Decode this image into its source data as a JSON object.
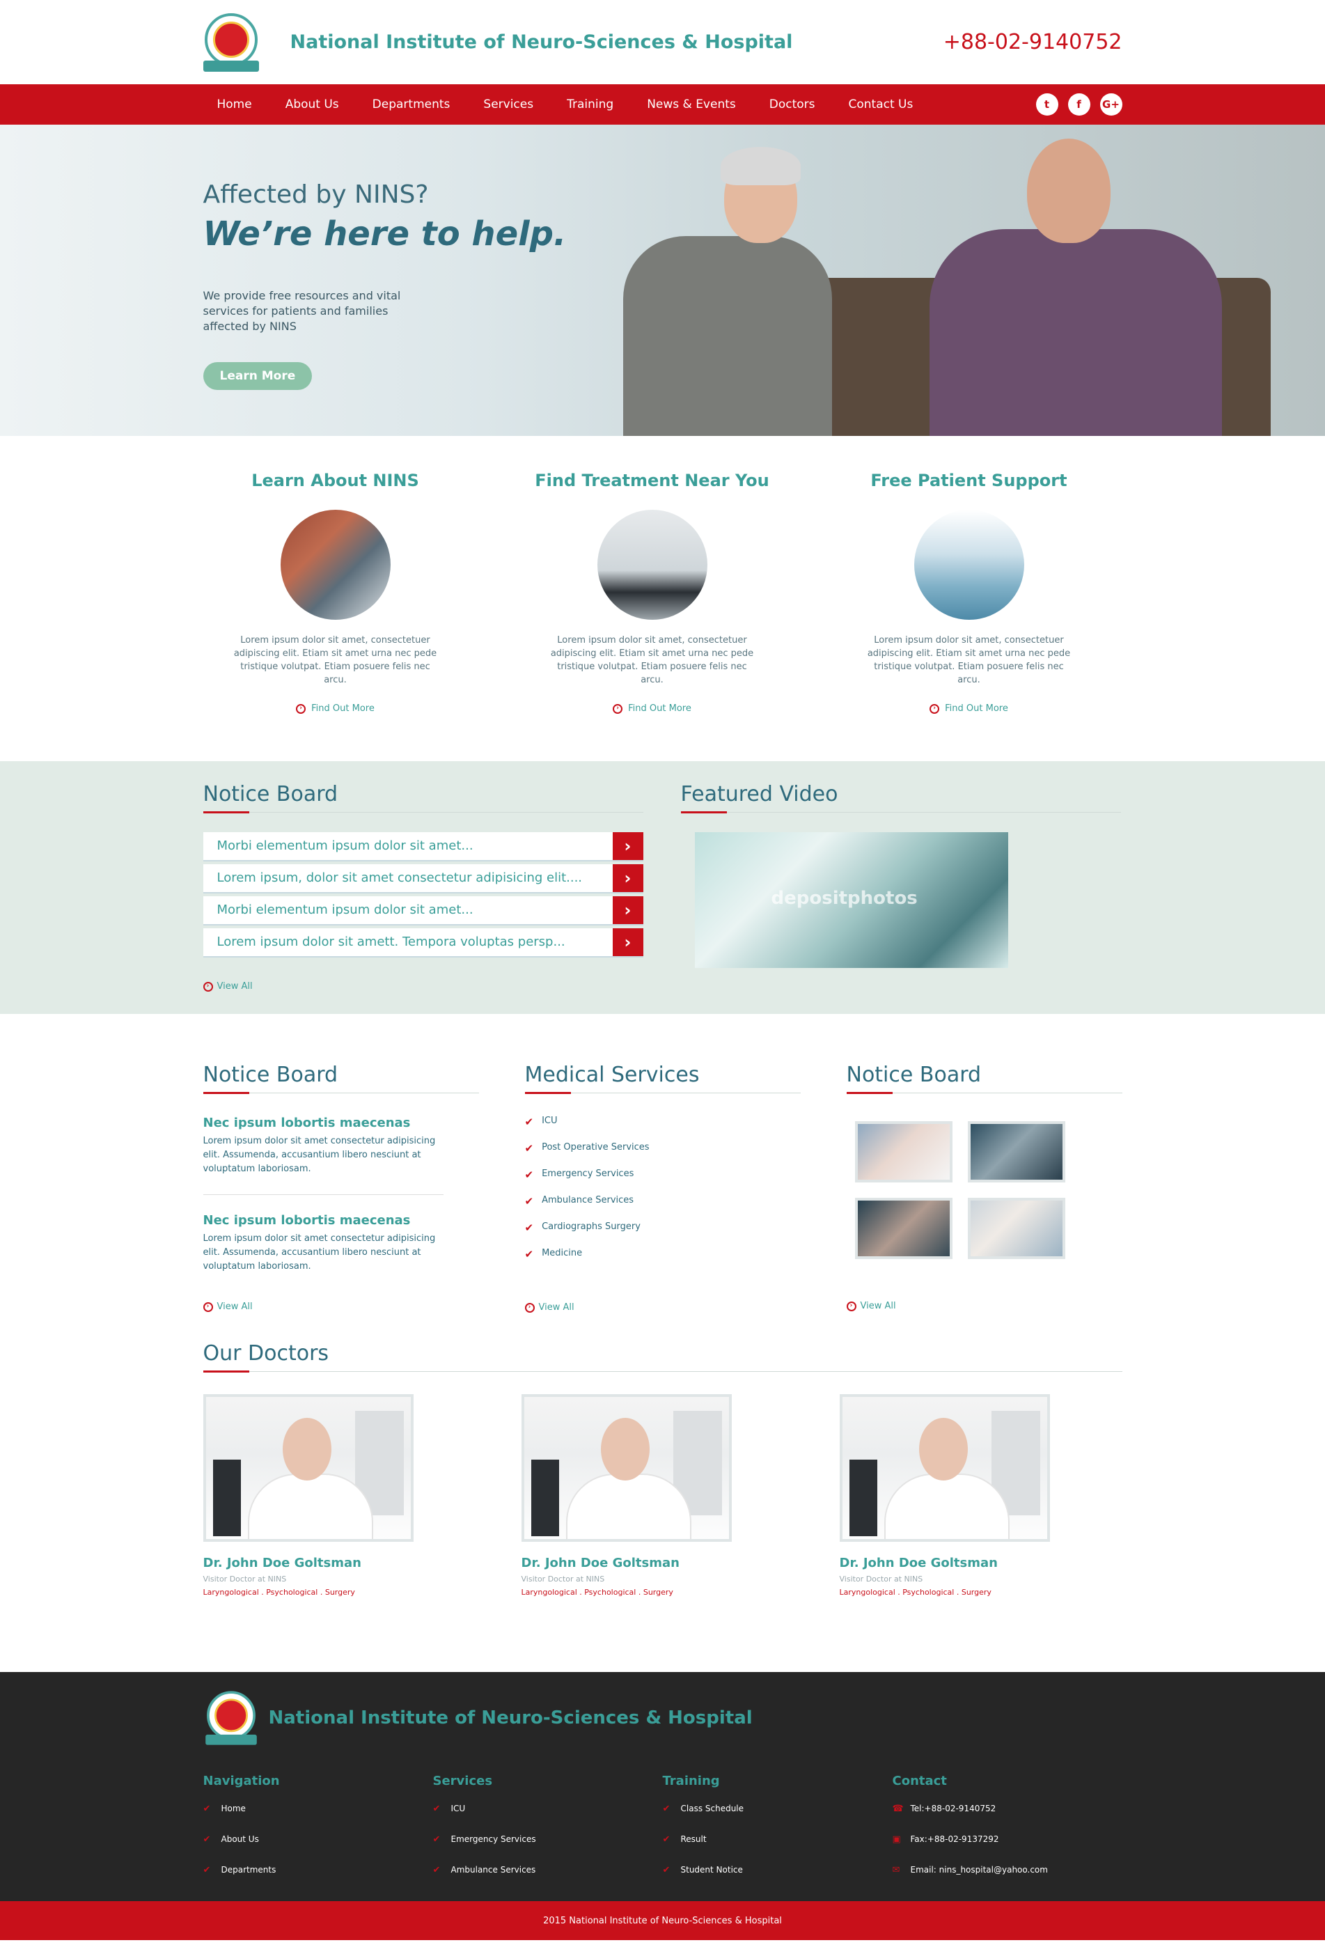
{
  "header": {
    "title": "National Institute of Neuro-Sciences & Hospital",
    "phone": "+88-02-9140752"
  },
  "nav": {
    "items": [
      "Home",
      "About Us",
      "Departments",
      "Services",
      "Training",
      "News & Events",
      "Doctors",
      "Contact Us"
    ],
    "social": [
      {
        "icon": "twitter-icon",
        "glyph": "t"
      },
      {
        "icon": "facebook-icon",
        "glyph": "f"
      },
      {
        "icon": "google-plus-icon",
        "glyph": "G+"
      }
    ]
  },
  "hero": {
    "question": "Affected by NINS?",
    "headline": "We’re here to help.",
    "text": "We provide free resources and vital services for patients and families affected by NINS",
    "button": "Learn More"
  },
  "features": [
    {
      "title": "Learn About NINS",
      "text": "Lorem ipsum dolor sit amet, consectetuer adipiscing elit. Etiam sit amet urna nec pede tristique volutpat. Etiam posuere felis nec arcu.",
      "link": "Find Out More"
    },
    {
      "title": "Find Treatment Near You",
      "text": "Lorem ipsum dolor sit amet, consectetuer adipiscing elit. Etiam sit amet urna nec pede tristique volutpat. Etiam posuere felis nec arcu.",
      "link": "Find Out More"
    },
    {
      "title": "Free Patient Support",
      "text": "Lorem ipsum dolor sit amet, consectetuer adipiscing elit. Etiam sit amet urna nec pede tristique volutpat. Etiam posuere felis nec arcu.",
      "link": "Find Out More"
    }
  ],
  "notice_board": {
    "title": "Notice Board",
    "items": [
      "Morbi elementum ipsum dolor sit amet...",
      "Lorem ipsum, dolor sit amet consectetur adipisicing elit....",
      "Morbi elementum ipsum dolor sit amet...",
      "Lorem ipsum dolor sit amett. Tempora voluptas persp..."
    ],
    "view_all": "View All"
  },
  "featured_video": {
    "title": "Featured Video",
    "watermark": "depositphotos"
  },
  "news": {
    "title": "Notice Board",
    "posts": [
      {
        "title": "Nec ipsum lobortis maecenas",
        "text": "Lorem ipsum dolor sit amet consectetur adipisicing elit. Assumenda, accusantium libero nesciunt at voluptatum laboriosam."
      },
      {
        "title": "Nec ipsum lobortis maecenas",
        "text": "Lorem ipsum dolor sit amet consectetur adipisicing elit. Assumenda, accusantium libero nesciunt at voluptatum laboriosam."
      }
    ],
    "view_all": "View All"
  },
  "medical_services": {
    "title": "Medical Services",
    "items": [
      "ICU",
      "Post Operative Services",
      "Emergency Services",
      "Ambulance Services",
      "Cardiographs Surgery",
      "Medicine"
    ],
    "view_all": "View All"
  },
  "gallery": {
    "title": "Notice Board",
    "view_all": "View All"
  },
  "doctors": {
    "title": "Our Doctors",
    "list": [
      {
        "name": "Dr. John Doe Goltsman",
        "role": "Visitor Doctor at NINS",
        "spec": "Laryngological . Psychological . Surgery"
      },
      {
        "name": "Dr. John Doe Goltsman",
        "role": "Visitor Doctor at NINS",
        "spec": "Laryngological . Psychological . Surgery"
      },
      {
        "name": "Dr. John Doe Goltsman",
        "role": "Visitor Doctor at NINS",
        "spec": "Laryngological . Psychological . Surgery"
      }
    ]
  },
  "footer": {
    "title": "National Institute of Neuro-Sciences & Hospital",
    "columns": [
      {
        "heading": "Navigation",
        "items": [
          "Home",
          "About Us",
          "Departments"
        ]
      },
      {
        "heading": "Services",
        "items": [
          "ICU",
          "Emergency Services",
          "Ambulance Services"
        ]
      },
      {
        "heading": "Training",
        "items": [
          "Class Schedule",
          "Result",
          "Student Notice"
        ]
      },
      {
        "heading": "Contact",
        "items": [
          "Tel:+88-02-9140752",
          "Fax:+88-02-9137292",
          "Email: nins_hospital@yahoo.com"
        ]
      }
    ],
    "copyright": "2015 National Institute of Neuro-Sciences & Hospital"
  },
  "colors": {
    "brand_red": "#c8101a",
    "teal": "#3a9e98",
    "footer_bg": "#262626"
  }
}
